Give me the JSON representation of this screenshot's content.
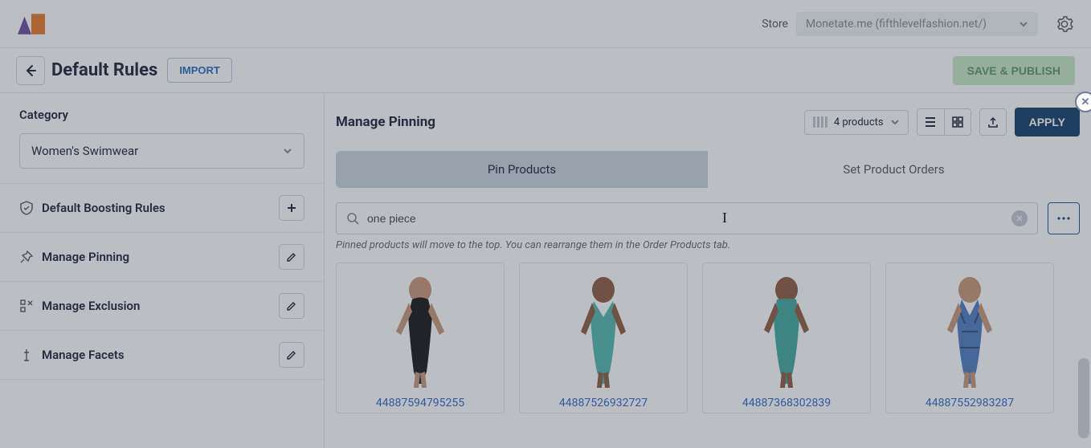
{
  "header": {
    "store_label": "Store",
    "store_value": "Monetate.me (fifthlevelfashion.net/)"
  },
  "page": {
    "title": "Default Rules",
    "import_label": "IMPORT",
    "save_label": "SAVE & PUBLISH"
  },
  "sidebar": {
    "category_label": "Category",
    "category_value": "Women's Swimwear",
    "items": [
      {
        "label": "Default Boosting Rules",
        "action": "plus"
      },
      {
        "label": "Manage Pinning",
        "action": "edit"
      },
      {
        "label": "Manage Exclusion",
        "action": "edit"
      },
      {
        "label": "Manage Facets",
        "action": "edit"
      }
    ]
  },
  "main": {
    "title": "Manage Pinning",
    "product_count": "4 products",
    "apply_label": "APPLY",
    "tabs": {
      "pin": "Pin Products",
      "order": "Set Product Orders"
    },
    "search_value": "one piece",
    "hint": "Pinned products will move to the top. You can rearrange them in the Order Products tab.",
    "products": [
      {
        "sku": "44887594795255",
        "style": "black-high"
      },
      {
        "sku": "44887526932727",
        "style": "teal-v"
      },
      {
        "sku": "44887368302839",
        "style": "teal-tank"
      },
      {
        "sku": "44887552983287",
        "style": "blue-halter"
      }
    ]
  }
}
